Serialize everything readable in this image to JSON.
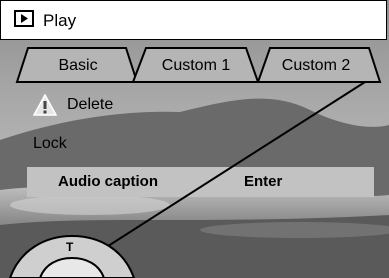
{
  "header": {
    "title": "Play",
    "icon": "play-icon"
  },
  "tabs": [
    {
      "label": "Basic"
    },
    {
      "label": "Custom 1"
    },
    {
      "label": "Custom 2"
    }
  ],
  "menu": {
    "delete": {
      "label": "Delete",
      "icon": "warning-icon"
    },
    "lock": {
      "label": "Lock"
    },
    "audio_caption": {
      "label": "Audio caption",
      "value": "Enter"
    }
  },
  "controller": {
    "label": "T"
  }
}
